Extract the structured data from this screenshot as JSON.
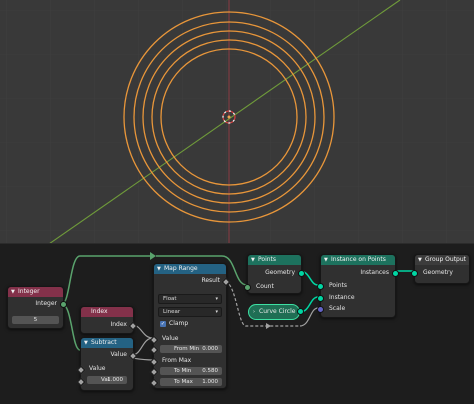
{
  "colors": {
    "viewport_bg": "#393939",
    "editor_bg": "#1d1d1d",
    "node_body": "#303030",
    "header_input": "#83314a",
    "header_converter": "#246283",
    "header_geometry": "#1d725e",
    "header_output": "#3c3c3c",
    "link_integer": "#5aa36d",
    "link_geometry": "#00d6a3",
    "link_float": "#a1a1a1",
    "circle_orange": "#e8963a",
    "axis_green": "#6f9b3a",
    "axis_red": "#a24a4a"
  },
  "nodes": {
    "integer": {
      "title": "Integer",
      "out_label": "Integer",
      "value": "5"
    },
    "index": {
      "title": "Index",
      "out_label": "Index"
    },
    "subtract": {
      "title": "Subtract",
      "out_label": "Value",
      "in_label": "Value",
      "val_label": "Val",
      "val_value": "1.000"
    },
    "map_range": {
      "title": "Map Range",
      "out_label": "Result",
      "data_type": "Float",
      "interpolation": "Linear",
      "clamp_label": "Clamp",
      "in_value_label": "Value",
      "from_min_label": "From Min",
      "from_min_value": "0.000",
      "from_max_label": "From Max",
      "to_min_label": "To Min",
      "to_min_value": "0.580",
      "to_max_label": "To Max",
      "to_max_value": "1.000"
    },
    "points": {
      "title": "Points",
      "out_label": "Geometry",
      "in_label": "Count"
    },
    "curve_circle": {
      "title": "Curve Circle"
    },
    "instance_on_points": {
      "title": "Instance on Points",
      "out_label": "Instances",
      "points_label": "Points",
      "instance_label": "Instance",
      "scale_label": "Scale"
    },
    "group_output": {
      "title": "Group Output",
      "in_label": "Geometry"
    }
  },
  "icons": {
    "collapse": "chevron-down-icon",
    "dropdown": "caret-down-icon",
    "check": "checkmark-icon"
  }
}
